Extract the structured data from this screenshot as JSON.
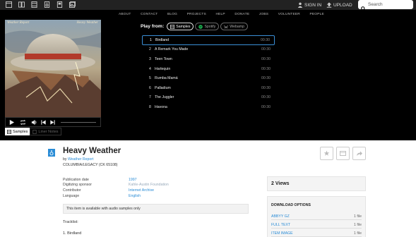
{
  "topnav": {
    "mediatypes": [
      "web-icon",
      "texts-icon",
      "video-icon",
      "audio-icon",
      "software-icon",
      "images-icon"
    ],
    "signin": "SIGN IN",
    "upload": "UPLOAD",
    "search_placeholder": "Search"
  },
  "subnav": [
    "ABOUT",
    "CONTACT",
    "BLOG",
    "PROJECTS",
    "HELP",
    "DONATE",
    "JOBS",
    "VOLUNTEER",
    "PEOPLE"
  ],
  "album": {
    "band": "Weather Report",
    "title": "Heavy Weather"
  },
  "viewtabs": {
    "samples": "Samples",
    "liner_notes": "Liner Notes"
  },
  "playfrom": {
    "label": "Play from:",
    "sources": [
      "Samples",
      "Spotify",
      "Webamp"
    ]
  },
  "tracks": [
    {
      "num": "1",
      "title": "Birdland",
      "dur": "00:30"
    },
    {
      "num": "2",
      "title": "A Remark You Made",
      "dur": "00:30"
    },
    {
      "num": "3",
      "title": "Teen Town",
      "dur": "00:30"
    },
    {
      "num": "4",
      "title": "Harlequin",
      "dur": "00:30"
    },
    {
      "num": "5",
      "title": "Rumba Mamá",
      "dur": "00:30"
    },
    {
      "num": "6",
      "title": "Palladium",
      "dur": "00:30"
    },
    {
      "num": "7",
      "title": "The Juggler",
      "dur": "00:30"
    },
    {
      "num": "8",
      "title": "Havona",
      "dur": "00:30"
    }
  ],
  "item": {
    "title": "Heavy Weather",
    "by_prefix": "by",
    "by_link": "Weather Report",
    "publisher": "COLUMBIA/LEGACY (CK 65108)"
  },
  "metadata": [
    {
      "key": "Publication date",
      "val": "1997"
    },
    {
      "key": "Digitizing sponsor",
      "val": "Kahle-Austin Foundation"
    },
    {
      "key": "Contributor",
      "val": "Internet Archive"
    },
    {
      "key": "Language",
      "val": "English"
    }
  ],
  "notice": "This item is available with audio samples only",
  "tracklist_label": "Tracklist:",
  "first_track": "1. Birdland",
  "views": "2 Views",
  "download": {
    "heading": "DOWNLOAD OPTIONS",
    "rows": [
      {
        "format": "ABBYY GZ",
        "count": "1 file"
      },
      {
        "format": "FULL TEXT",
        "count": "1 file"
      },
      {
        "format": "ITEM IMAGE",
        "count": "1 file"
      }
    ]
  },
  "colors": {
    "accent": "#2a8cd6",
    "theater_bg": "#000000",
    "topbar_bg": "#222222"
  }
}
